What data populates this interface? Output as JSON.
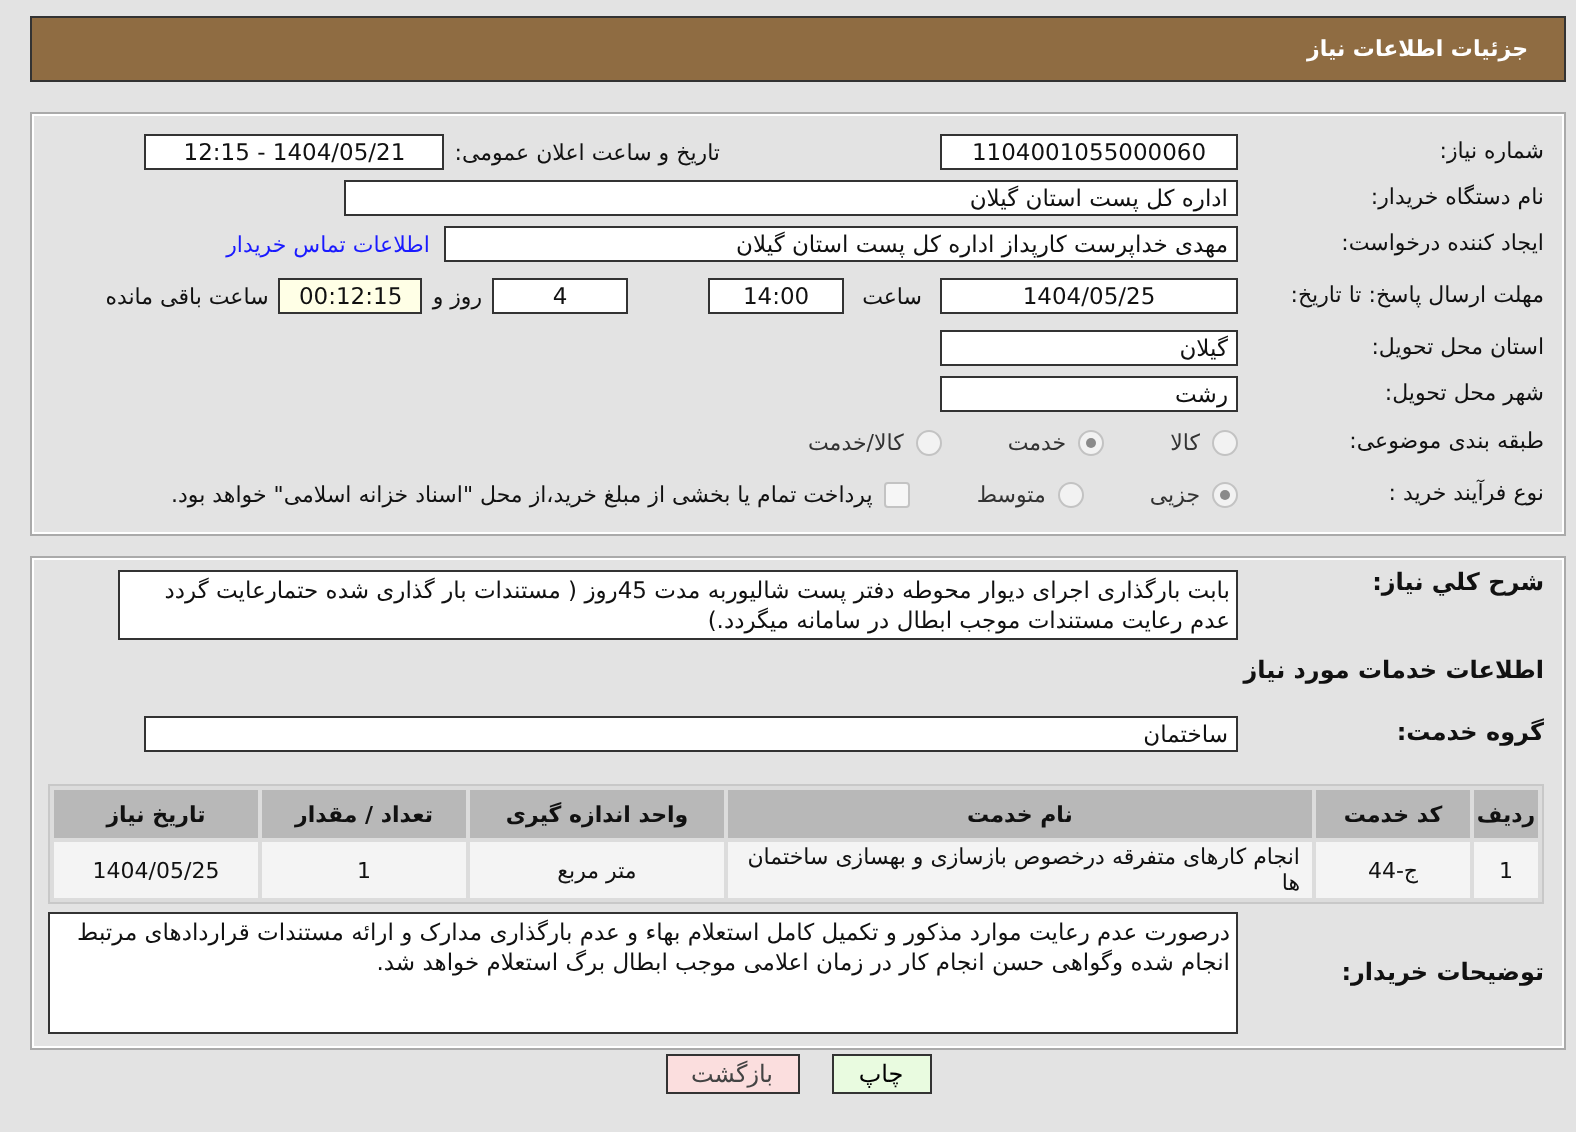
{
  "header": {
    "title": "جزئیات اطلاعات نیاز"
  },
  "need_number": {
    "label": "شماره نیاز:",
    "value": "1104001055000060"
  },
  "announce": {
    "label": "تاریخ و ساعت اعلان عمومی:",
    "value": "1404/05/21 - 12:15"
  },
  "buyer": {
    "label": "نام دستگاه خریدار:",
    "value": "اداره کل پست استان گیلان"
  },
  "creator": {
    "label": "ایجاد کننده درخواست:",
    "value": "مهدی  خداپرست  کارپداز  اداره کل پست استان گیلان",
    "link": "اطلاعات تماس خریدار"
  },
  "deadline": {
    "label": "مهلت ارسال پاسخ: تا تاریخ:",
    "date": "1404/05/25",
    "time_label": "ساعت",
    "time": "14:00",
    "days": "4",
    "days_label": "روز و",
    "remaining": "00:12:15",
    "remaining_label": "ساعت باقی مانده"
  },
  "province": {
    "label": "استان محل تحویل:",
    "value": "گیلان"
  },
  "city": {
    "label": "شهر محل تحویل:",
    "value": "رشت"
  },
  "category": {
    "label": "طبقه بندی موضوعی:",
    "options": [
      {
        "label": "کالا",
        "selected": false
      },
      {
        "label": "خدمت",
        "selected": true
      },
      {
        "label": "کالا/خدمت",
        "selected": false
      }
    ]
  },
  "process": {
    "label": "نوع فرآیند خرید :",
    "options": [
      {
        "label": "جزیی",
        "selected": true
      },
      {
        "label": "متوسط",
        "selected": false
      }
    ],
    "payment": {
      "label": "پرداخت تمام یا بخشی از مبلغ خرید،از محل \"اسناد خزانه اسلامی\" خواهد بود.",
      "checked": false
    }
  },
  "description": {
    "label": "شرح کلي نياز:",
    "value": "بابت بارگذاری اجرای دیوار محوطه دفتر پست شالیوربه مدت 45روز ( مستندات بار گذاری شده حتمارعایت گردد عدم رعایت مستندات موجب ابطال در سامانه میگردد.)"
  },
  "services_title": "اطلاعات خدمات مورد نیاز",
  "service_group": {
    "label": "گروه خدمت:",
    "value": "ساختمان"
  },
  "table": {
    "columns": [
      "ردیف",
      "کد خدمت",
      "نام خدمت",
      "واحد اندازه گیری",
      "تعداد / مقدار",
      "تاریخ نیاز"
    ],
    "rows": [
      [
        "1",
        "ج-44",
        "انجام کارهای متفرقه درخصوص بازسازی و بهسازی ساختمان ها",
        "متر مربع",
        "1",
        "1404/05/25"
      ]
    ]
  },
  "buyer_notes": {
    "label": "توضیحات خریدار:",
    "value": "درصورت عدم رعایت موارد مذکور و تکمیل کامل استعلام بهاء و عدم بارگذاری مدارک و ارائه مستندات قراردادهای مرتبط انجام شده وگواهی حسن انجام کار در زمان اعلامی موجب ابطال برگ استعلام خواهد شد."
  },
  "buttons": [
    {
      "label": "چاپ",
      "kind": "print"
    },
    {
      "label": "بازگشت",
      "kind": "back"
    }
  ]
}
